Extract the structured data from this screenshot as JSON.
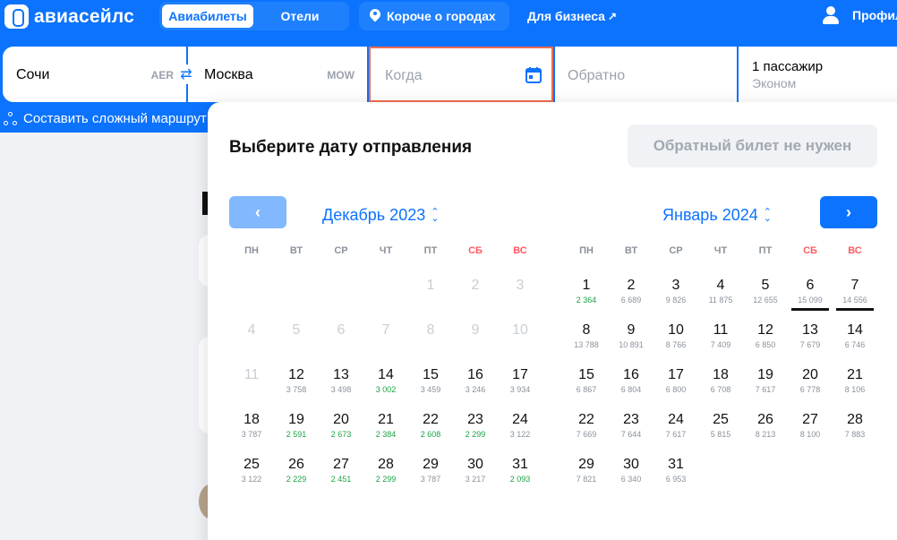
{
  "header": {
    "logo_text": "авиасейлс",
    "tabs": [
      "Авиабилеты",
      "Отели"
    ],
    "city_button": "Короче о городах",
    "business_link": "Для бизнеса",
    "business_arrow": "↗",
    "profile_label": "Профиль"
  },
  "search": {
    "from_city": "Сочи",
    "from_code": "AER",
    "to_city": "Москва",
    "to_code": "MOW",
    "when_placeholder": "Когда",
    "return_placeholder": "Обратно",
    "passengers": "1 пассажир",
    "cabin": "Эконом",
    "swap_symbol": "⇄"
  },
  "complex_route": "Составить сложный маршрут",
  "calendar": {
    "title": "Выберите дату отправления",
    "no_return": "Обратный билет не нужен",
    "prev_symbol": "‹",
    "next_symbol": "›",
    "updown_symbol": "⌃⌄",
    "weekdays": [
      "ПН",
      "ВТ",
      "СР",
      "ЧТ",
      "ПТ",
      "СБ",
      "ВС"
    ],
    "colors": {
      "accent": "#0c73fe",
      "cheap_price": "#1ca346",
      "weekend": "#ff5a5f",
      "selected_field_border": "#ef6d51"
    },
    "months": [
      {
        "title": "Декабрь 2023",
        "leading_blanks": 4,
        "days": [
          {
            "d": "1",
            "p": "",
            "off": true
          },
          {
            "d": "2",
            "p": "",
            "off": true
          },
          {
            "d": "3",
            "p": "",
            "off": true
          },
          {
            "d": "4",
            "p": "",
            "off": true
          },
          {
            "d": "5",
            "p": "",
            "off": true
          },
          {
            "d": "6",
            "p": "",
            "off": true
          },
          {
            "d": "7",
            "p": "",
            "off": true
          },
          {
            "d": "8",
            "p": "",
            "off": true
          },
          {
            "d": "9",
            "p": "",
            "off": true
          },
          {
            "d": "10",
            "p": "",
            "off": true
          },
          {
            "d": "11",
            "p": "",
            "off": true
          },
          {
            "d": "12",
            "p": "3 758"
          },
          {
            "d": "13",
            "p": "3 498"
          },
          {
            "d": "14",
            "p": "3 002",
            "cheap": true
          },
          {
            "d": "15",
            "p": "3 459"
          },
          {
            "d": "16",
            "p": "3 246"
          },
          {
            "d": "17",
            "p": "3 934"
          },
          {
            "d": "18",
            "p": "3 787"
          },
          {
            "d": "19",
            "p": "2 591",
            "cheap": true
          },
          {
            "d": "20",
            "p": "2 673",
            "cheap": true
          },
          {
            "d": "21",
            "p": "2 384",
            "cheap": true
          },
          {
            "d": "22",
            "p": "2 608",
            "cheap": true
          },
          {
            "d": "23",
            "p": "2 299",
            "cheap": true
          },
          {
            "d": "24",
            "p": "3 122"
          },
          {
            "d": "25",
            "p": "3 122"
          },
          {
            "d": "26",
            "p": "2 229",
            "cheap": true
          },
          {
            "d": "27",
            "p": "2 451",
            "cheap": true
          },
          {
            "d": "28",
            "p": "2 299",
            "cheap": true
          },
          {
            "d": "29",
            "p": "3 787"
          },
          {
            "d": "30",
            "p": "3 217"
          },
          {
            "d": "31",
            "p": "2 093",
            "cheap": true
          }
        ]
      },
      {
        "title": "Январь 2024",
        "leading_blanks": 0,
        "days": [
          {
            "d": "1",
            "p": "2 364",
            "cheap": true
          },
          {
            "d": "2",
            "p": "6 689"
          },
          {
            "d": "3",
            "p": "9 826"
          },
          {
            "d": "4",
            "p": "11 875"
          },
          {
            "d": "5",
            "p": "12 655"
          },
          {
            "d": "6",
            "p": "15 099",
            "under": true
          },
          {
            "d": "7",
            "p": "14 556",
            "under": true
          },
          {
            "d": "8",
            "p": "13 788"
          },
          {
            "d": "9",
            "p": "10 891"
          },
          {
            "d": "10",
            "p": "8 766"
          },
          {
            "d": "11",
            "p": "7 409"
          },
          {
            "d": "12",
            "p": "6 850"
          },
          {
            "d": "13",
            "p": "7 679"
          },
          {
            "d": "14",
            "p": "6 746"
          },
          {
            "d": "15",
            "p": "6 867"
          },
          {
            "d": "16",
            "p": "6 804"
          },
          {
            "d": "17",
            "p": "6 800"
          },
          {
            "d": "18",
            "p": "6 708"
          },
          {
            "d": "19",
            "p": "7 617"
          },
          {
            "d": "20",
            "p": "6 778"
          },
          {
            "d": "21",
            "p": "8 106"
          },
          {
            "d": "22",
            "p": "7 669"
          },
          {
            "d": "23",
            "p": "7 644"
          },
          {
            "d": "24",
            "p": "7 617"
          },
          {
            "d": "25",
            "p": "5 815"
          },
          {
            "d": "26",
            "p": "8 213"
          },
          {
            "d": "27",
            "p": "8 100"
          },
          {
            "d": "28",
            "p": "7 883"
          },
          {
            "d": "29",
            "p": "7 821"
          },
          {
            "d": "30",
            "p": "6 340"
          },
          {
            "d": "31",
            "p": "6 953"
          }
        ]
      }
    ]
  }
}
